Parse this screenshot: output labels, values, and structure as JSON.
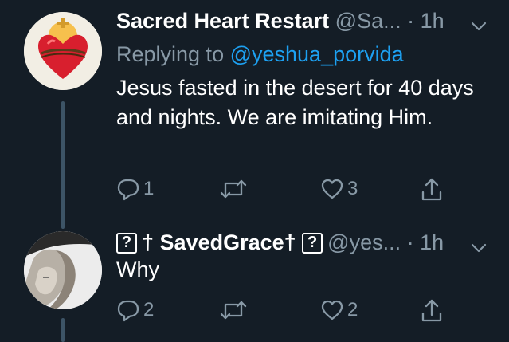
{
  "tweets": [
    {
      "name": "Sacred Heart Restart",
      "handle": "@Sa...",
      "dot": "·",
      "time": "1h",
      "replying_prefix": "Replying to ",
      "replying_handle": "@yeshua_porvida",
      "text": "Jesus fasted in the desert for 40 days and nights.  We are imitating Him.",
      "reply_count": "1",
      "retweet_count": "",
      "like_count": "3"
    },
    {
      "name_box_1": "?",
      "name": "† SavedGrace†",
      "name_box_2": "?",
      "handle": "@yes...",
      "dot": "·",
      "time": "1h",
      "text": "Why",
      "reply_count": "2",
      "retweet_count": "",
      "like_count": "2"
    }
  ],
  "colors": {
    "background": "#141d26",
    "secondary_text": "#8899a6",
    "link": "#1da1f2",
    "thread_line": "#3d5466"
  }
}
